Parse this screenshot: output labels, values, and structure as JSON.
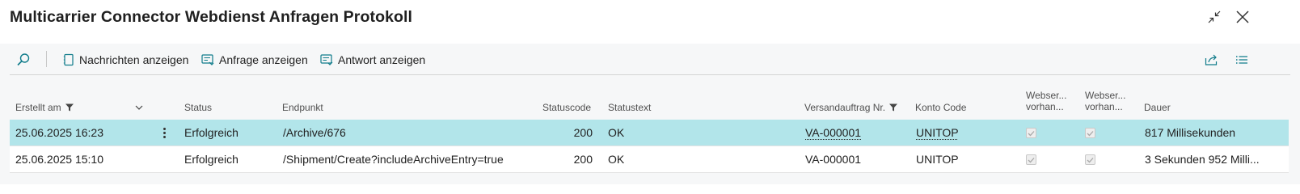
{
  "window": {
    "title": "Multicarrier Connector Webdienst Anfragen Protokoll"
  },
  "actions": {
    "show_messages": "Nachrichten anzeigen",
    "show_request": "Anfrage anzeigen",
    "show_response": "Antwort anzeigen"
  },
  "columns": {
    "created_at": "Erstellt am",
    "status": "Status",
    "endpoint": "Endpunkt",
    "status_code": "Statuscode",
    "status_text": "Statustext",
    "shipment_no": "Versandauftrag Nr.",
    "account_code": "Konto Code",
    "webser1_line1": "Webser...",
    "webser1_line2": "vorhan...",
    "webser2_line1": "Webser...",
    "webser2_line2": "vorhan...",
    "duration": "Dauer"
  },
  "rows": [
    {
      "created_at": "25.06.2025 16:23",
      "status": "Erfolgreich",
      "endpoint": "/Archive/676",
      "status_code": "200",
      "status_text": "OK",
      "shipment_no": "VA-000001",
      "account_code": "UNITOP",
      "webser1_checked": true,
      "webser2_checked": true,
      "duration": "817 Millisekunden",
      "selected": true
    },
    {
      "created_at": "25.06.2025 15:10",
      "status": "Erfolgreich",
      "endpoint": "/Shipment/Create?includeArchiveEntry=true",
      "status_code": "200",
      "status_text": "OK",
      "shipment_no": "VA-000001",
      "account_code": "UNITOP",
      "webser1_checked": true,
      "webser2_checked": true,
      "duration": "3 Sekunden 952 Milli...",
      "selected": false
    }
  ],
  "colors": {
    "accent": "#0f7b8a",
    "selected_row": "#b2e5ea",
    "background": "#f6f7f8"
  },
  "icons": {
    "collapse": "collapse-icon",
    "close": "close-icon",
    "search": "search-icon",
    "messages": "document-icon",
    "request": "request-icon",
    "response": "response-icon",
    "share": "share-icon",
    "list_view": "list-icon",
    "filter": "filter-icon",
    "chevron": "chevron-down-icon",
    "row_menu": "more-vertical-icon"
  }
}
